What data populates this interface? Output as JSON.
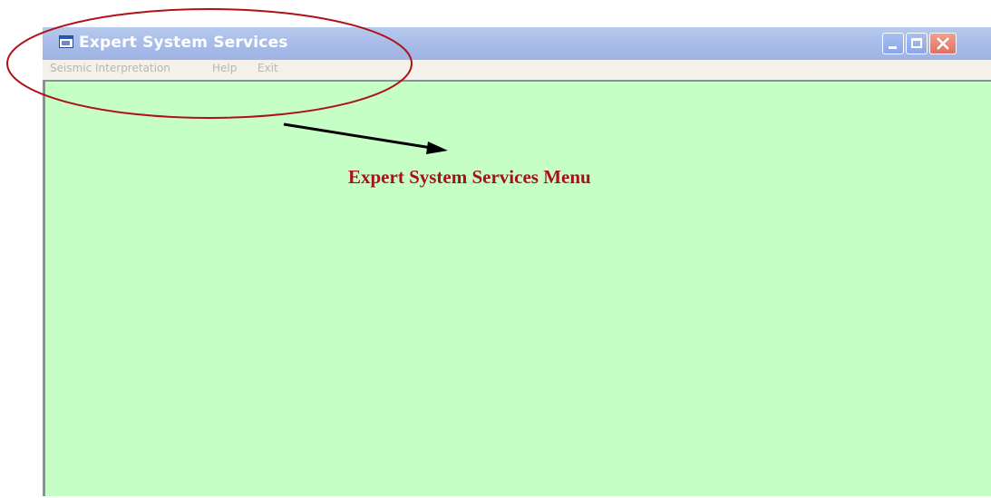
{
  "window": {
    "title": "Expert System Services",
    "icon": "app-window-icon",
    "controls": [
      "minimize-icon",
      "maximize-icon",
      "close-icon"
    ]
  },
  "menubar": {
    "items": [
      {
        "label": "Seismic Interpretation"
      },
      {
        "label": "Help"
      },
      {
        "label": "Exit"
      }
    ]
  },
  "annotation": {
    "label": "Expert System Services Menu",
    "color": "#a8101a"
  },
  "colors": {
    "client_background": "#c5ffc6",
    "titlebar": "#a8bce8",
    "menubar": "#f3f1ea"
  }
}
